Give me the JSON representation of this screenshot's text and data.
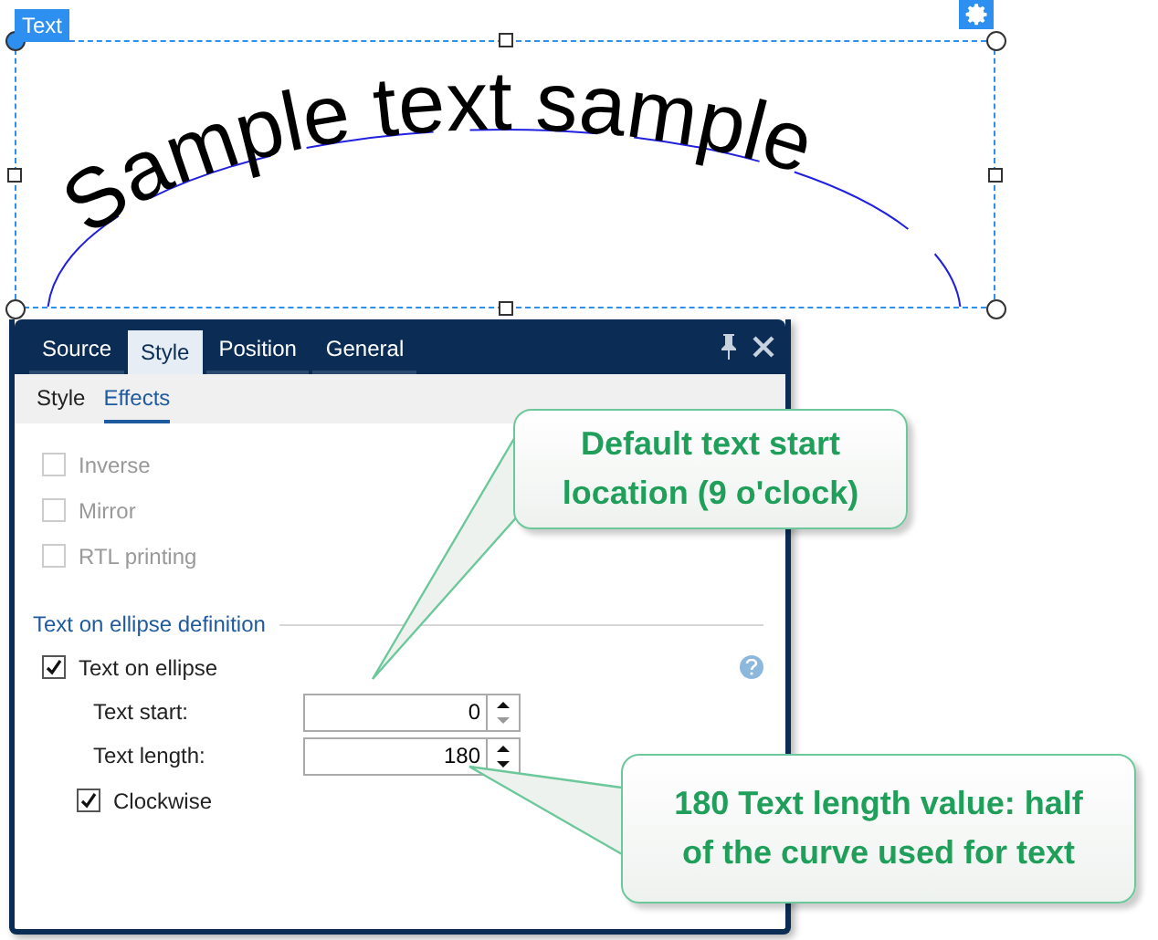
{
  "canvas": {
    "object_tag": "Text",
    "curved_text": "Sample text sample"
  },
  "panel": {
    "tabs": [
      {
        "label": "Source",
        "selected": false
      },
      {
        "label": "Style",
        "selected": true
      },
      {
        "label": "Position",
        "selected": false
      },
      {
        "label": "General",
        "selected": false
      }
    ],
    "subtabs": [
      {
        "label": "Style",
        "selected": false
      },
      {
        "label": "Effects",
        "selected": true
      }
    ],
    "options": [
      {
        "label": "Inverse",
        "checked": false,
        "disabled": true
      },
      {
        "label": "Mirror",
        "checked": false,
        "disabled": true
      },
      {
        "label": "RTL printing",
        "checked": false,
        "disabled": true
      }
    ],
    "section": "Text on ellipse definition",
    "text_on_ellipse": {
      "label": "Text on ellipse",
      "checked": true
    },
    "fields": [
      {
        "label": "Text start:",
        "value": "0"
      },
      {
        "label": "Text length:",
        "value": "180"
      }
    ],
    "clockwise": {
      "label": "Clockwise",
      "checked": true
    }
  },
  "callouts": [
    {
      "lines": [
        "Default text start",
        "location (9 o'clock)"
      ]
    },
    {
      "lines": [
        "180 Text length value: half",
        "of the curve used for text"
      ]
    }
  ]
}
